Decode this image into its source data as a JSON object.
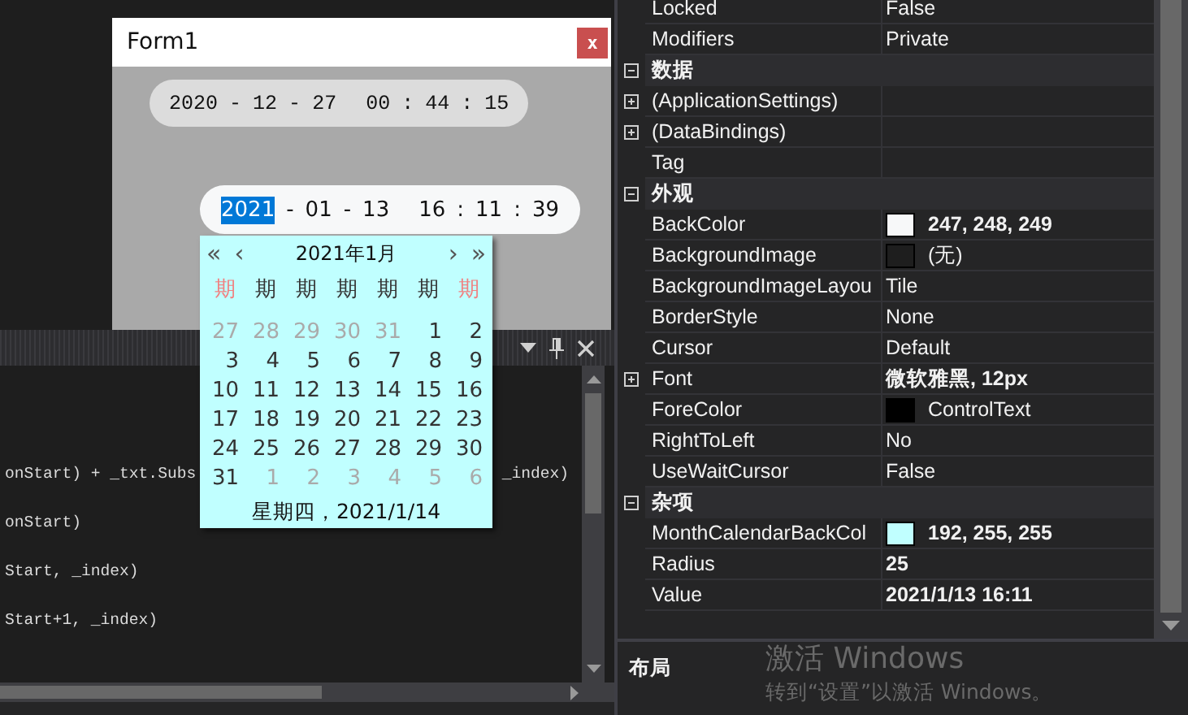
{
  "form": {
    "title": "Form1",
    "close": "x",
    "pickers": [
      {
        "date": [
          {
            "text": "2020",
            "selected": false
          },
          {
            "text": "-",
            "selected": false
          },
          {
            "text": "12",
            "selected": false
          },
          {
            "text": "-",
            "selected": false
          },
          {
            "text": "27",
            "selected": false
          }
        ],
        "time": [
          {
            "text": "00",
            "selected": false
          },
          {
            "text": ":",
            "selected": false
          },
          {
            "text": "44",
            "selected": false
          },
          {
            "text": ":",
            "selected": false
          },
          {
            "text": "15",
            "selected": false
          }
        ],
        "focused": false
      },
      {
        "date": [
          {
            "text": "2021",
            "selected": true
          },
          {
            "text": "-",
            "selected": false
          },
          {
            "text": "01",
            "selected": false
          },
          {
            "text": "-",
            "selected": false
          },
          {
            "text": "13",
            "selected": false
          }
        ],
        "time": [
          {
            "text": "16",
            "selected": false
          },
          {
            "text": ":",
            "selected": false
          },
          {
            "text": "11",
            "selected": false
          },
          {
            "text": ":",
            "selected": false
          },
          {
            "text": "39",
            "selected": false
          }
        ],
        "focused": true
      }
    ]
  },
  "calendar": {
    "prev_year": "«",
    "prev_month": "‹",
    "title": "2021年1月",
    "next_month": "›",
    "next_year": "»",
    "weekdays": [
      {
        "text": "期",
        "weekend": true
      },
      {
        "text": "期",
        "weekend": false
      },
      {
        "text": "期",
        "weekend": false
      },
      {
        "text": "期",
        "weekend": false
      },
      {
        "text": "期",
        "weekend": false
      },
      {
        "text": "期",
        "weekend": false
      },
      {
        "text": "期",
        "weekend": true
      }
    ],
    "weeks": [
      [
        {
          "day": "27",
          "other_month": true
        },
        {
          "day": "28",
          "other_month": true
        },
        {
          "day": "29",
          "other_month": true
        },
        {
          "day": "30",
          "other_month": true
        },
        {
          "day": "31",
          "other_month": true
        },
        {
          "day": "1",
          "other_month": false
        },
        {
          "day": "2",
          "other_month": false
        }
      ],
      [
        {
          "day": "3",
          "other_month": false
        },
        {
          "day": "4",
          "other_month": false
        },
        {
          "day": "5",
          "other_month": false
        },
        {
          "day": "6",
          "other_month": false
        },
        {
          "day": "7",
          "other_month": false
        },
        {
          "day": "8",
          "other_month": false
        },
        {
          "day": "9",
          "other_month": false
        }
      ],
      [
        {
          "day": "10",
          "other_month": false
        },
        {
          "day": "11",
          "other_month": false
        },
        {
          "day": "12",
          "other_month": false
        },
        {
          "day": "13",
          "other_month": false
        },
        {
          "day": "14",
          "other_month": false
        },
        {
          "day": "15",
          "other_month": false
        },
        {
          "day": "16",
          "other_month": false
        }
      ],
      [
        {
          "day": "17",
          "other_month": false
        },
        {
          "day": "18",
          "other_month": false
        },
        {
          "day": "19",
          "other_month": false
        },
        {
          "day": "20",
          "other_month": false
        },
        {
          "day": "21",
          "other_month": false
        },
        {
          "day": "22",
          "other_month": false
        },
        {
          "day": "23",
          "other_month": false
        }
      ],
      [
        {
          "day": "24",
          "other_month": false
        },
        {
          "day": "25",
          "other_month": false
        },
        {
          "day": "26",
          "other_month": false
        },
        {
          "day": "27",
          "other_month": false
        },
        {
          "day": "28",
          "other_month": false
        },
        {
          "day": "29",
          "other_month": false
        },
        {
          "day": "30",
          "other_month": false
        }
      ],
      [
        {
          "day": "31",
          "other_month": false
        },
        {
          "day": "1",
          "other_month": true
        },
        {
          "day": "2",
          "other_month": true
        },
        {
          "day": "3",
          "other_month": true
        },
        {
          "day": "4",
          "other_month": true
        },
        {
          "day": "5",
          "other_month": true
        },
        {
          "day": "6",
          "other_month": true
        }
      ]
    ],
    "footer": "星期四，2021/1/14"
  },
  "code_editor": {
    "lines": [
      {
        "parts": [
          "onStart) + _txt.Subs",
          "_index)"
        ]
      },
      {
        "parts": [
          "onStart)"
        ]
      },
      {
        "parts": [
          "Start, _index)"
        ]
      },
      {
        "parts": [
          "Start+1, _index)"
        ]
      }
    ]
  },
  "properties": {
    "rows": [
      {
        "kind": "property",
        "name": "Locked",
        "value": "False",
        "modified": false
      },
      {
        "kind": "property",
        "name": "Modifiers",
        "value": "Private",
        "modified": false
      },
      {
        "kind": "category",
        "name": "数据",
        "expanded": true
      },
      {
        "kind": "property",
        "name": "(ApplicationSettings)",
        "expanded": false
      },
      {
        "kind": "property",
        "name": "(DataBindings)",
        "expanded": false
      },
      {
        "kind": "property",
        "name": "Tag"
      },
      {
        "kind": "category",
        "name": "外观",
        "expanded": true
      },
      {
        "kind": "property",
        "name": "BackColor",
        "value": "247, 248, 249",
        "modified": true,
        "swatch": true,
        "color": "#f7f8f9"
      },
      {
        "kind": "property",
        "name": "BackgroundImage",
        "value": "(无)",
        "modified": false,
        "swatch": true
      },
      {
        "kind": "property",
        "name": "BackgroundImageLayou",
        "value": "Tile",
        "modified": false
      },
      {
        "kind": "property",
        "name": "BorderStyle",
        "value": "None",
        "modified": false
      },
      {
        "kind": "property",
        "name": "Cursor",
        "value": "Default",
        "modified": false
      },
      {
        "kind": "property",
        "name": "Font",
        "value": "微软雅黑, 12px",
        "modified": true,
        "expanded": false
      },
      {
        "kind": "property",
        "name": "ForeColor",
        "value": "ControlText",
        "modified": false,
        "swatch": true,
        "color": "#000000"
      },
      {
        "kind": "property",
        "name": "RightToLeft",
        "value": "No",
        "modified": false
      },
      {
        "kind": "property",
        "name": "UseWaitCursor",
        "value": "False",
        "modified": false
      },
      {
        "kind": "category",
        "name": "杂项",
        "expanded": true
      },
      {
        "kind": "property",
        "name": "MonthCalendarBackCol",
        "value": "192, 255, 255",
        "modified": true,
        "swatch": true,
        "color": "#c0ffff"
      },
      {
        "kind": "property",
        "name": "Radius",
        "value": "25",
        "modified": true
      },
      {
        "kind": "property",
        "name": "Value",
        "value": "2021/1/13 16:11",
        "modified": true
      }
    ],
    "description": "布局"
  },
  "activation_notice": {
    "title": "激活 Windows",
    "message": "转到“设置”以激活 Windows。"
  }
}
